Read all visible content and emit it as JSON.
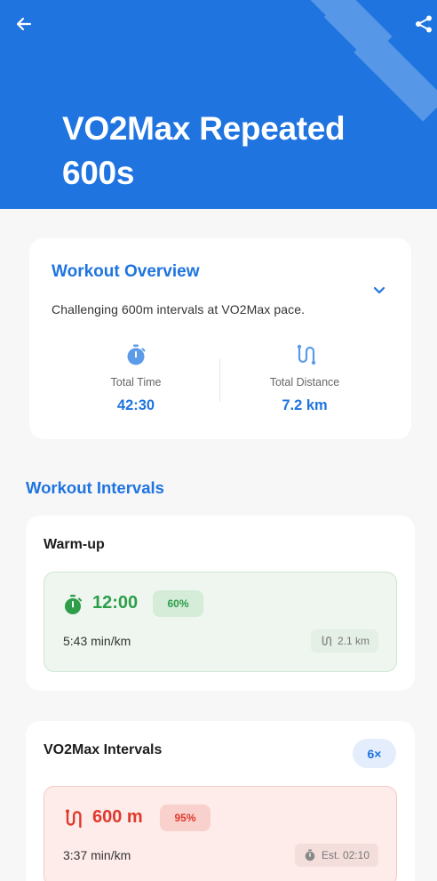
{
  "header": {
    "title": "VO2Max Repeated 600s",
    "colors": {
      "primary": "#1f74e0"
    }
  },
  "overview": {
    "title": "Workout Overview",
    "description": "Challenging 600m intervals at VO2Max pace.",
    "total_time_label": "Total Time",
    "total_time_value": "42:30",
    "total_distance_label": "Total Distance",
    "total_distance_value": "7.2 km"
  },
  "intervals_section_title": "Workout Intervals",
  "intervals": [
    {
      "title": "Warm-up",
      "value": "12:00",
      "intensity": "60%",
      "pace": "5:43 min/km",
      "chip": "2.1 km",
      "chip_icon": "route-icon",
      "value_icon": "stopwatch-icon",
      "color": "#2e9e4b"
    },
    {
      "title": "VO2Max Intervals",
      "repetitions": "6×",
      "value": "600 m",
      "intensity": "95%",
      "pace": "3:37 min/km",
      "chip": "Est. 02:10",
      "chip_icon": "stopwatch-icon",
      "value_icon": "route-icon",
      "color": "#e0392c"
    }
  ]
}
